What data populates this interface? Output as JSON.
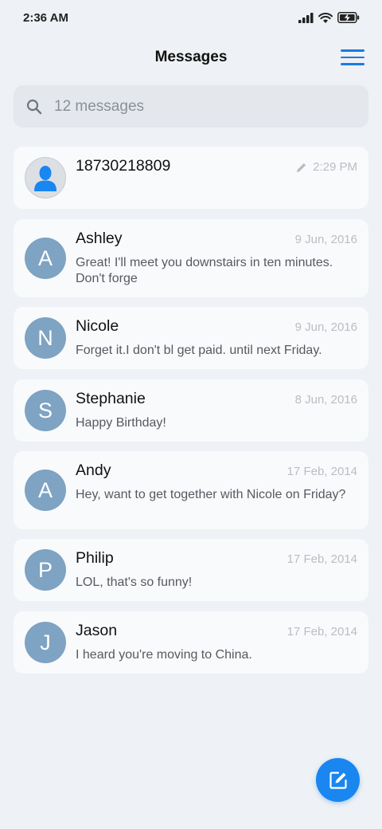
{
  "status_bar": {
    "time": "2:36 AM",
    "icons": [
      "signal-icon",
      "wifi-icon",
      "battery-charging-icon"
    ]
  },
  "header": {
    "title": "Messages",
    "menu_icon": "hamburger-menu-icon"
  },
  "search": {
    "placeholder": "12 messages",
    "icon": "search-icon"
  },
  "messages": [
    {
      "name": "18730218809",
      "avatar": "",
      "date": "2:29 PM",
      "draft": true,
      "preview": ""
    },
    {
      "name": "Ashley",
      "avatar": "A",
      "date": "9 Jun, 2016",
      "preview": "Great! I'll meet you downstairs in ten minutes. Don't forge"
    },
    {
      "name": "Nicole",
      "avatar": "N",
      "date": "9 Jun, 2016",
      "preview": "Forget it.I don't bl get paid. until next Friday."
    },
    {
      "name": "Stephanie",
      "avatar": "S",
      "date": "8 Jun, 2016",
      "preview": "Happy Birthday!"
    },
    {
      "name": "Andy",
      "avatar": "A",
      "date": "17 Feb, 2014",
      "preview": "Hey, want to get together with Nicole on Friday?"
    },
    {
      "name": "Philip",
      "avatar": "P",
      "date": "17 Feb, 2014",
      "preview": "LOL, that's so funny!"
    },
    {
      "name": "Jason",
      "avatar": "J",
      "date": "17 Feb, 2014",
      "preview": "I heard you're moving to China."
    }
  ],
  "fab": {
    "icon": "compose-icon"
  },
  "colors": {
    "accent": "#1a86f0",
    "avatar_bg": "#7ea3c3",
    "background": "#eef1f5",
    "card": "#f9fafc"
  }
}
